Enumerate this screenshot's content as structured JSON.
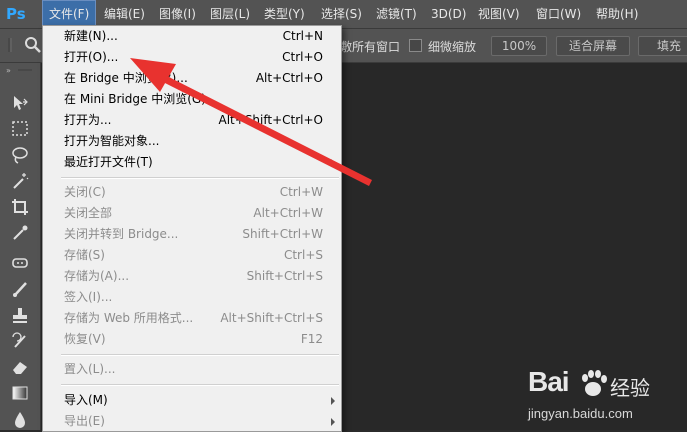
{
  "app": {
    "logo": "Ps"
  },
  "menubar": [
    {
      "label": "文件(F)"
    },
    {
      "label": "编辑(E)"
    },
    {
      "label": "图像(I)"
    },
    {
      "label": "图层(L)"
    },
    {
      "label": "类型(Y)"
    },
    {
      "label": "选择(S)"
    },
    {
      "label": "滤镜(T)"
    },
    {
      "label": "3D(D)"
    },
    {
      "label": "视图(V)"
    },
    {
      "label": "窗口(W)"
    },
    {
      "label": "帮助(H)"
    }
  ],
  "options": {
    "all_windows_label": "敷所有窗口",
    "scrubby_zoom_label": "细微缩放",
    "zoom_100_label": "100%",
    "fit_screen_label": "适合屏幕",
    "fill_screen_label": "填充"
  },
  "file_menu": [
    {
      "label": "新建(N)...",
      "shortcut": "Ctrl+N",
      "enabled": true
    },
    {
      "label": "打开(O)...",
      "shortcut": "Ctrl+O",
      "enabled": true
    },
    {
      "label": "在 Bridge 中浏览(B)...",
      "shortcut": "Alt+Ctrl+O",
      "enabled": true
    },
    {
      "label": "在 Mini Bridge 中浏览(G)...",
      "shortcut": "",
      "enabled": true
    },
    {
      "label": "打开为...",
      "shortcut": "Alt+Shift+Ctrl+O",
      "enabled": true
    },
    {
      "label": "打开为智能对象...",
      "shortcut": "",
      "enabled": true
    },
    {
      "label": "最近打开文件(T)",
      "shortcut": "",
      "enabled": true,
      "submenu": true
    },
    {
      "label": "关闭(C)",
      "shortcut": "Ctrl+W",
      "enabled": false
    },
    {
      "label": "关闭全部",
      "shortcut": "Alt+Ctrl+W",
      "enabled": false
    },
    {
      "label": "关闭并转到 Bridge...",
      "shortcut": "Shift+Ctrl+W",
      "enabled": false
    },
    {
      "label": "存储(S)",
      "shortcut": "Ctrl+S",
      "enabled": false
    },
    {
      "label": "存储为(A)...",
      "shortcut": "Shift+Ctrl+S",
      "enabled": false
    },
    {
      "label": "签入(I)...",
      "shortcut": "",
      "enabled": false
    },
    {
      "label": "存储为 Web 所用格式...",
      "shortcut": "Alt+Shift+Ctrl+S",
      "enabled": false
    },
    {
      "label": "恢复(V)",
      "shortcut": "F12",
      "enabled": false
    },
    {
      "label": "置入(L)...",
      "shortcut": "",
      "enabled": false
    },
    {
      "label": "导入(M)",
      "shortcut": "",
      "enabled": true,
      "submenu": true
    },
    {
      "label": "导出(E)",
      "shortcut": "",
      "enabled": false,
      "submenu": true
    }
  ],
  "watermark": {
    "brand": "Bai",
    "brand2": "经验",
    "url": "jingyan.baidu.com"
  },
  "colors": {
    "arrow": "#e8322f",
    "menu_active": "#3c6ea8",
    "ps_blue": "#31a8ff"
  }
}
